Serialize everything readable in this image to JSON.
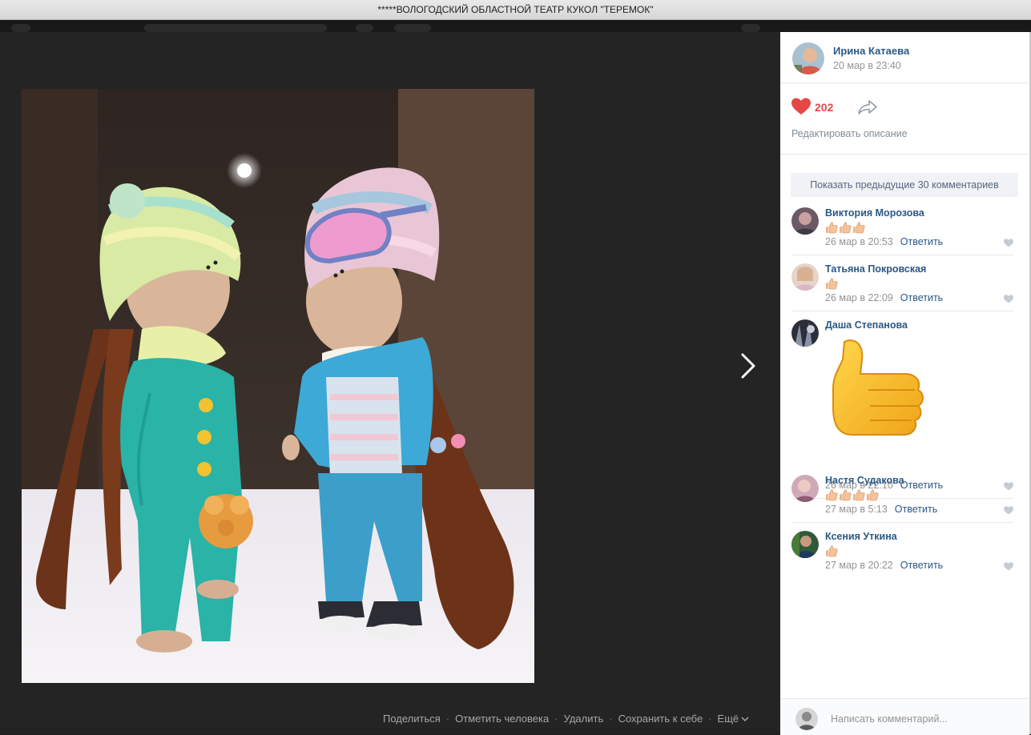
{
  "window": {
    "title": "*****ВОЛОГОДСКИЙ ОБЛАСТНОЙ ТЕАТР КУКОЛ \"ТЕРЕМОК\""
  },
  "photo_actions": [
    "Поделиться",
    "Отметить человека",
    "Удалить",
    "Сохранить к себе",
    "Ещё"
  ],
  "post": {
    "author": "Ирина Катаева",
    "date": "20 мар в 23:40",
    "likes": "202",
    "edit_description": "Редактировать описание"
  },
  "comments_block": {
    "show_previous": "Показать предыдущие 30 комментариев",
    "reply_label": "Ответить",
    "items": [
      {
        "name": "Виктория Морозова",
        "thumbs": 3,
        "date": "26 мар в 20:53"
      },
      {
        "name": "Татьяна Покровская",
        "thumbs": 1,
        "date": "26 мар в 22:09"
      },
      {
        "name": "Даша Степанова",
        "sticker": "thumbs-up-sticker",
        "date": "26 мар в 22:10"
      },
      {
        "name": "Настя Судакова",
        "thumbs": 4,
        "date": "27 мар в 5:13"
      },
      {
        "name": "Ксения Уткина",
        "thumbs": 1,
        "date": "27 мар в 20:22"
      }
    ]
  },
  "composer": {
    "placeholder": "Написать комментарий..."
  },
  "colors": {
    "link": "#2a5885",
    "like": "#e64646",
    "muted": "#939393",
    "viewer_bg": "#242424"
  }
}
